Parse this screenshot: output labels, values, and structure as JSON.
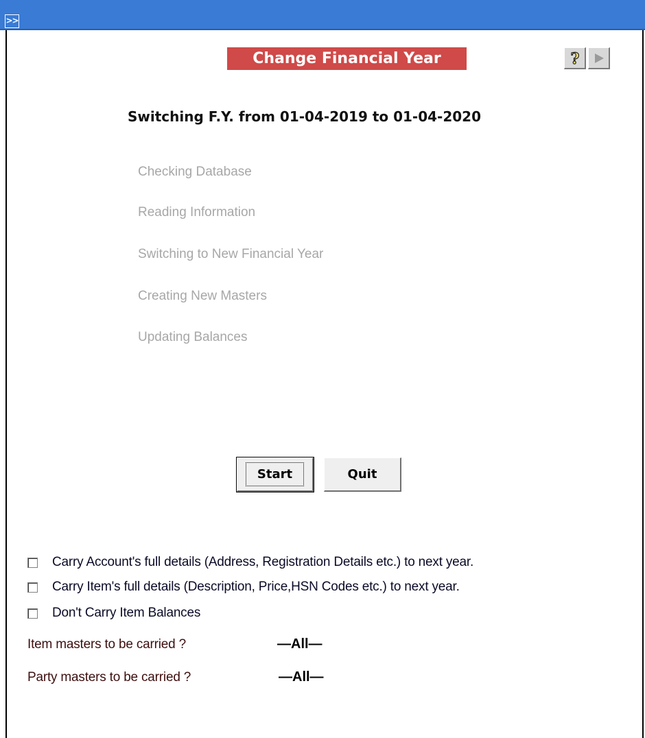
{
  "toolbar": {
    "expand_label": ">>"
  },
  "dialog": {
    "title": "Change Financial Year",
    "heading": "Switching F.Y. from 01-04-2019 to 01-04-2020",
    "steps": [
      "Checking Database",
      "Reading Information",
      "Switching to New Financial Year",
      "Creating New Masters",
      "Updating Balances"
    ],
    "buttons": {
      "start": "Start",
      "quit": "Quit"
    },
    "options": [
      {
        "label": "Carry Account's full details (Address, Registration Details etc.) to next year.",
        "checked": false
      },
      {
        "label": "Carry Item's full details (Description, Price,HSN Codes etc.) to next year.",
        "checked": false
      },
      {
        "label": "Don't Carry Item Balances",
        "checked": false
      }
    ],
    "masters": {
      "item_label": "Item masters to be carried ?",
      "item_value": "—All—",
      "party_label": "Party masters to be carried ?",
      "party_value": "—All—"
    }
  },
  "colors": {
    "titlebar": "#3a7bd5",
    "banner": "#cf4a49",
    "step_text": "#a7a7a7"
  },
  "icons": [
    "help-icon",
    "next-arrow-icon"
  ]
}
